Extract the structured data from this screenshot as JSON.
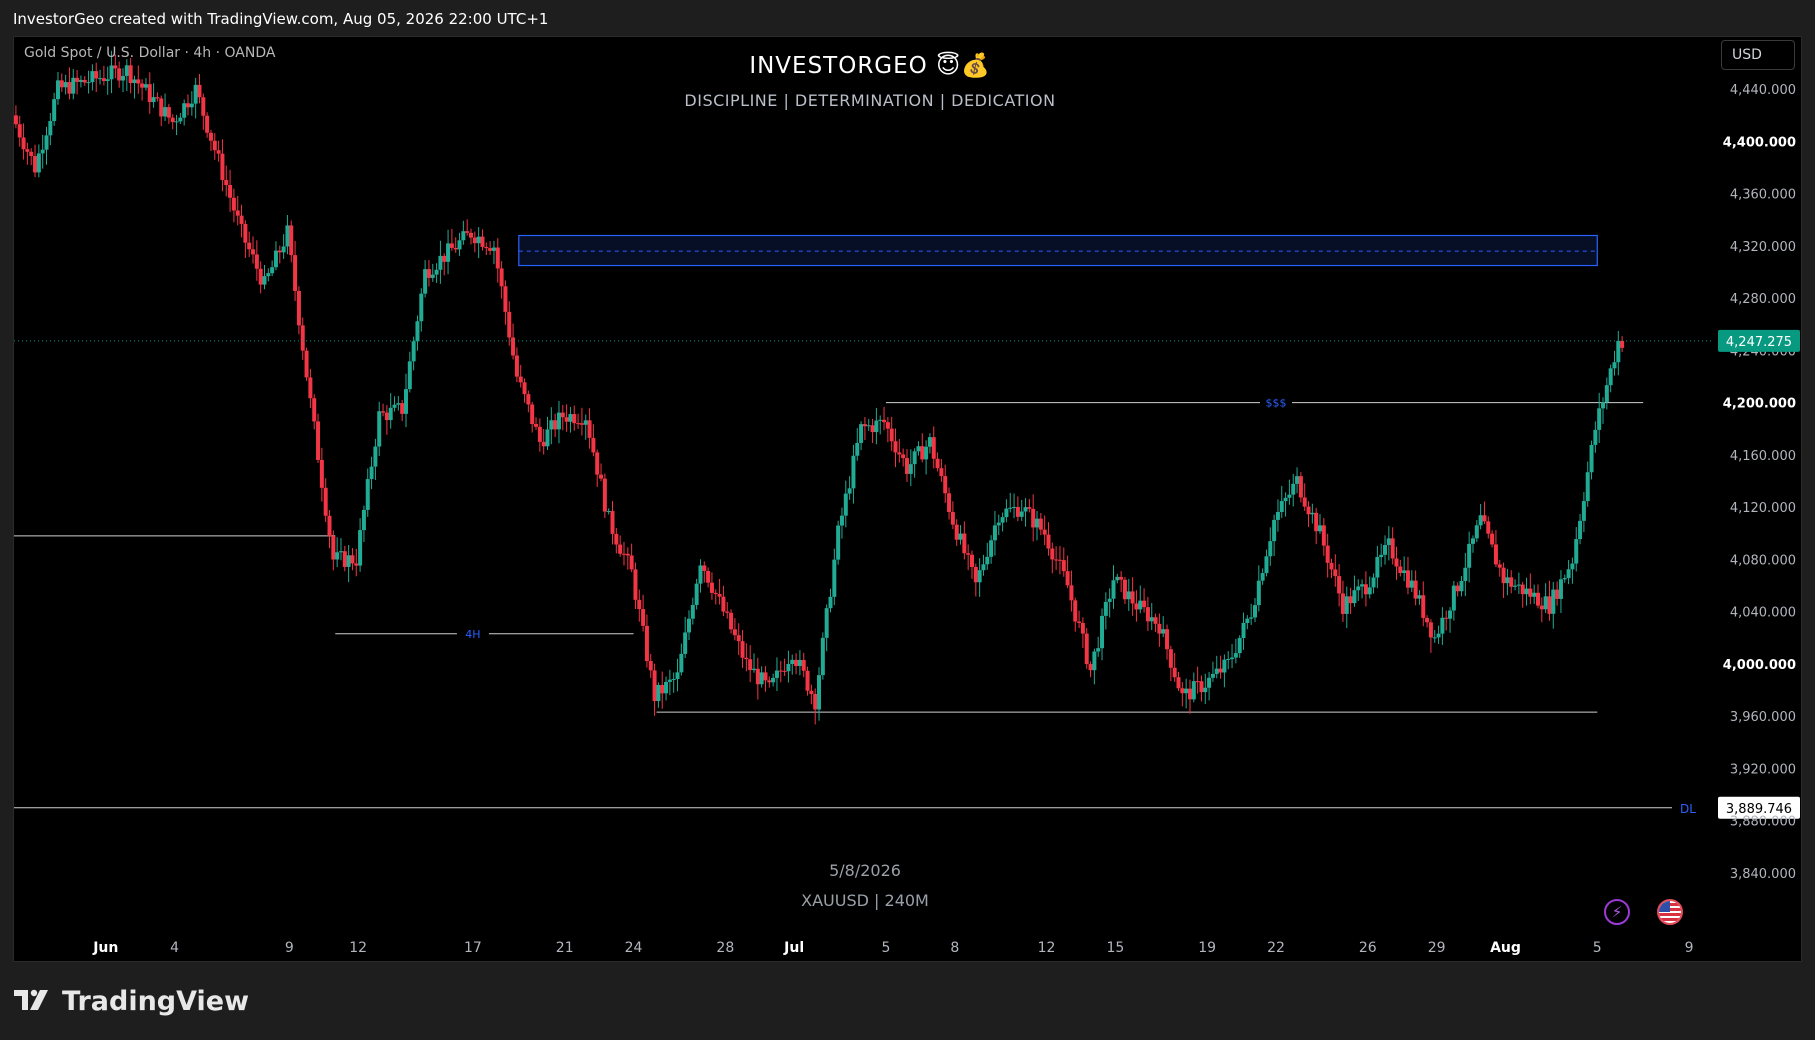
{
  "header": {
    "credit": "InvestorGeo created with TradingView.com, Aug 05, 2026 22:00 UTC+1"
  },
  "symbol_info": "Gold Spot / U.S. Dollar · 4h · OANDA",
  "brand": {
    "title": "INVESTORGEO 😇💰",
    "subtitle": "DISCIPLINE  |  DETERMINATION | DEDICATION"
  },
  "watermark": {
    "date": "5/8/2026",
    "symbol": "XAUUSD | 240M"
  },
  "currency_button": "USD",
  "footer": {
    "logo_text": "TradingView"
  },
  "icons": {
    "lightning": "lightning-icon",
    "flag": "us-flag-icon"
  },
  "colors": {
    "up": "#22ab94",
    "down": "#f23645",
    "background": "#000000",
    "zone": "#2962ff",
    "last_price": "#089981"
  },
  "chart_data": {
    "type": "candlestick",
    "symbol": "XAUUSD",
    "interval": "4h",
    "x_range": [
      "2026-05-28",
      "2026-08-10"
    ],
    "ylim": [
      3800,
      4480
    ],
    "y_ticks": [
      3840,
      3880,
      3920,
      3960,
      4000,
      4040,
      4080,
      4120,
      4160,
      4200,
      4240,
      4280,
      4320,
      4360,
      4400,
      4440
    ],
    "y_tick_labels": [
      "3,840.000",
      "3,880.000",
      "3,920.000",
      "3,960.000",
      "4,000.000",
      "4,040.000",
      "4,080.000",
      "4,120.000",
      "4,160.000",
      "4,200.000",
      "4,240.000",
      "4,280.000",
      "4,320.000",
      "4,360.000",
      "4,400.000",
      "4,440.000"
    ],
    "bold_y_ticks": [
      4000,
      4200,
      4400
    ],
    "x_ticks": [
      {
        "date": "2026-06-01",
        "label": "Jun",
        "bold": true
      },
      {
        "date": "2026-06-04",
        "label": "4"
      },
      {
        "date": "2026-06-09",
        "label": "9"
      },
      {
        "date": "2026-06-12",
        "label": "12"
      },
      {
        "date": "2026-06-17",
        "label": "17"
      },
      {
        "date": "2026-06-21",
        "label": "21"
      },
      {
        "date": "2026-06-24",
        "label": "24"
      },
      {
        "date": "2026-06-28",
        "label": "28"
      },
      {
        "date": "2026-07-01",
        "label": "Jul",
        "bold": true
      },
      {
        "date": "2026-07-05",
        "label": "5"
      },
      {
        "date": "2026-07-08",
        "label": "8"
      },
      {
        "date": "2026-07-12",
        "label": "12"
      },
      {
        "date": "2026-07-15",
        "label": "15"
      },
      {
        "date": "2026-07-19",
        "label": "19"
      },
      {
        "date": "2026-07-22",
        "label": "22"
      },
      {
        "date": "2026-07-26",
        "label": "26"
      },
      {
        "date": "2026-07-29",
        "label": "29"
      },
      {
        "date": "2026-08-01",
        "label": "Aug",
        "bold": true
      },
      {
        "date": "2026-08-05",
        "label": "5"
      },
      {
        "date": "2026-08-09",
        "label": "9"
      }
    ],
    "price_path": [
      [
        "2026-05-28",
        4420
      ],
      [
        "2026-05-29",
        4380
      ],
      [
        "2026-05-30",
        4440
      ],
      [
        "2026-06-01",
        4450
      ],
      [
        "2026-06-02",
        4455
      ],
      [
        "2026-06-04",
        4415
      ],
      [
        "2026-06-05",
        4440
      ],
      [
        "2026-06-07",
        4330
      ],
      [
        "2026-06-08",
        4290
      ],
      [
        "2026-06-09",
        4330
      ],
      [
        "2026-06-10",
        4200
      ],
      [
        "2026-06-11",
        4080
      ],
      [
        "2026-06-12",
        4080
      ],
      [
        "2026-06-13",
        4190
      ],
      [
        "2026-06-14",
        4195
      ],
      [
        "2026-06-15",
        4300
      ],
      [
        "2026-06-17",
        4330
      ],
      [
        "2026-06-18",
        4320
      ],
      [
        "2026-06-19",
        4220
      ],
      [
        "2026-06-20",
        4170
      ],
      [
        "2026-06-21",
        4190
      ],
      [
        "2026-06-22",
        4190
      ],
      [
        "2026-06-23",
        4110
      ],
      [
        "2026-06-24",
        4070
      ],
      [
        "2026-06-25",
        3975
      ],
      [
        "2026-06-26",
        3990
      ],
      [
        "2026-06-27",
        4080
      ],
      [
        "2026-06-29",
        4000
      ],
      [
        "2026-06-30",
        3980
      ],
      [
        "2026-07-01",
        4010
      ],
      [
        "2026-07-02",
        3972
      ],
      [
        "2026-07-03",
        4100
      ],
      [
        "2026-07-04",
        4180
      ],
      [
        "2026-07-05",
        4185
      ],
      [
        "2026-07-06",
        4150
      ],
      [
        "2026-07-07",
        4170
      ],
      [
        "2026-07-08",
        4110
      ],
      [
        "2026-07-09",
        4060
      ],
      [
        "2026-07-10",
        4115
      ],
      [
        "2026-07-11",
        4120
      ],
      [
        "2026-07-12",
        4100
      ],
      [
        "2026-07-13",
        4060
      ],
      [
        "2026-07-14",
        3995
      ],
      [
        "2026-07-15",
        4065
      ],
      [
        "2026-07-16",
        4045
      ],
      [
        "2026-07-17",
        4030
      ],
      [
        "2026-07-18",
        3975
      ],
      [
        "2026-07-19",
        3985
      ],
      [
        "2026-07-20",
        4000
      ],
      [
        "2026-07-21",
        4040
      ],
      [
        "2026-07-22",
        4110
      ],
      [
        "2026-07-23",
        4140
      ],
      [
        "2026-07-24",
        4100
      ],
      [
        "2026-07-25",
        4045
      ],
      [
        "2026-07-26",
        4060
      ],
      [
        "2026-07-27",
        4090
      ],
      [
        "2026-07-28",
        4060
      ],
      [
        "2026-07-29",
        4020
      ],
      [
        "2026-07-30",
        4060
      ],
      [
        "2026-07-31",
        4110
      ],
      [
        "2026-08-01",
        4065
      ],
      [
        "2026-08-02",
        4055
      ],
      [
        "2026-08-03",
        4045
      ],
      [
        "2026-08-04",
        4080
      ],
      [
        "2026-08-05",
        4180
      ],
      [
        "2026-08-06",
        4247
      ]
    ],
    "last_price": 4247.275,
    "last_price_label": "4,247.275",
    "zone": {
      "from": "2026-06-19",
      "to": "2026-08-05",
      "low": 4305,
      "high": 4328,
      "mid": 4316
    },
    "levels": [
      {
        "price": 4200,
        "from": "2026-07-05",
        "to": "2026-08-07",
        "label": "$$$",
        "label_date": "2026-07-22"
      },
      {
        "price": 4098,
        "from": "2026-05-28",
        "to": "2026-06-11"
      },
      {
        "price": 4023,
        "from": "2026-06-11",
        "to": "2026-06-24",
        "label": "4H",
        "label_date": "2026-06-17"
      },
      {
        "price": 3963,
        "from": "2026-06-25",
        "to": "2026-08-05"
      },
      {
        "price": 3889.746,
        "from": "2026-05-28",
        "to": "2026-08-10",
        "label": "DL",
        "price_label": "3,889.746"
      }
    ],
    "grid": false,
    "legend": "none"
  }
}
